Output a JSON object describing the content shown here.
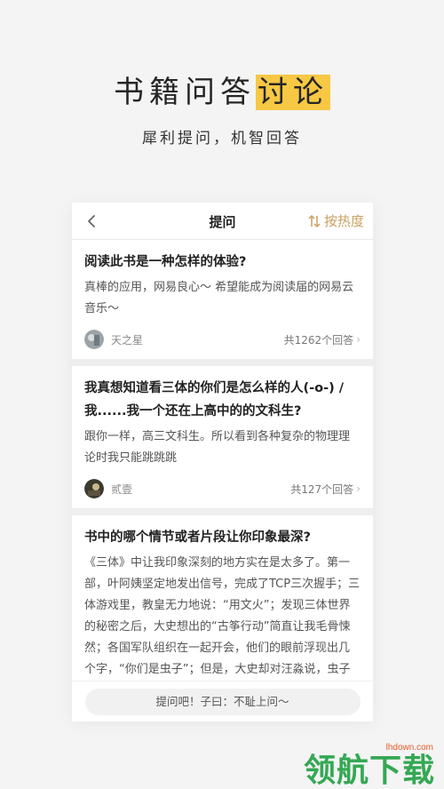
{
  "headline": {
    "plain": "书籍问答",
    "highlight": "讨论"
  },
  "tagline": "犀利提问，机智回答",
  "navbar": {
    "title": "提问",
    "sort_label": "按热度"
  },
  "questions": [
    {
      "title": "阅读此书是一种怎样的体验?",
      "body": "真棒的应用，网易良心～ 希望能成为阅读届的网易云音乐～",
      "user": "天之星",
      "answers": "共1262个回答"
    },
    {
      "title": "我真想知道看三体的你们是怎么样的人(-o-) / 我......我一个还在上高中的的文科生?",
      "body": "跟你一样，高三文科生。所以看到各种复杂的物理理论时我只能跳跳跳",
      "user": "贰壹",
      "answers": "共127个回答"
    },
    {
      "title": "书中的哪个情节或者片段让你印象最深?",
      "body": "《三体》中让我印象深刻的地方实在是太多了。第一部，叶阿姨坚定地发出信号，完成了TCP三次握手；三体游戏里，教皇无力地说：“用文火”；发现三体世界的秘密之后，大史想出的“古筝行动”简直让我毛骨悚然；各国军队组织在一起开会，他们的眼前浮现出几个字，“你们是虫子”；但是，大史却对汪淼说，虫子从来没有被消灭过……第二部……"
    }
  ],
  "ask_placeholder": "提问吧！子曰：不耻上问～",
  "watermark": {
    "url": "lhdown.com",
    "text": "领航下载"
  },
  "colors": {
    "highlight": "#f7c843",
    "accent": "#c9a063",
    "watermark": "#34a853"
  }
}
